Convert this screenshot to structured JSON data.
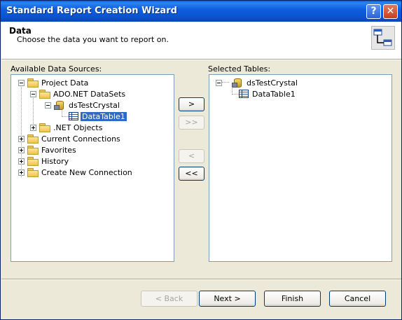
{
  "window": {
    "title": "Standard Report Creation Wizard",
    "help_label": "?",
    "close_label": "✕"
  },
  "header": {
    "title": "Data",
    "subtitle": "Choose the data you want to report on."
  },
  "available": {
    "label": "Available Data Sources:",
    "nodes": [
      {
        "label": "Project Data",
        "icon": "folder-icon",
        "expanded": true
      },
      {
        "label": "ADO.NET DataSets",
        "icon": "folder-icon",
        "expanded": true
      },
      {
        "label": "dsTestCrystal",
        "icon": "dataset-icon",
        "expanded": true
      },
      {
        "label": "DataTable1",
        "icon": "table-icon",
        "selected": true
      },
      {
        "label": ".NET Objects",
        "icon": "folder-icon",
        "expanded": false
      },
      {
        "label": "Current Connections",
        "icon": "folder-icon",
        "expanded": false
      },
      {
        "label": "Favorites",
        "icon": "folder-icon",
        "expanded": false
      },
      {
        "label": "History",
        "icon": "folder-icon",
        "expanded": false
      },
      {
        "label": "Create New Connection",
        "icon": "folder-icon",
        "expanded": false
      }
    ]
  },
  "selected": {
    "label": "Selected Tables:",
    "nodes": [
      {
        "label": "dsTestCrystal",
        "icon": "dataset-icon",
        "expanded": true
      },
      {
        "label": "DataTable1",
        "icon": "table-icon"
      }
    ]
  },
  "move_buttons": {
    "add": ">",
    "add_all": ">>",
    "remove": "<",
    "remove_all": "<<"
  },
  "footer": {
    "back": "< Back",
    "next": "Next >",
    "finish": "Finish",
    "cancel": "Cancel"
  },
  "colors": {
    "titlebar": "#0a5fd8",
    "selection": "#316ac5",
    "dialog_bg": "#ece9d8"
  }
}
